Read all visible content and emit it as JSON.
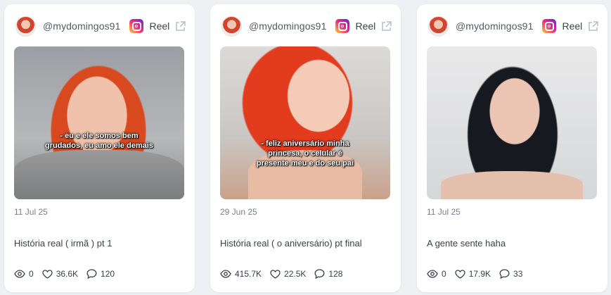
{
  "cards": [
    {
      "handle": "@mydomingos91",
      "type": "Reel",
      "caption": "- eu e ele somos bem\ngrudados, eu amo ele demais",
      "date": "11 Jul 25",
      "title": "História real ( irmã ) pt 1",
      "views": "0",
      "likes": "36.6K",
      "comments": "120"
    },
    {
      "handle": "@mydomingos91",
      "type": "Reel",
      "caption": "- feliz aniversário minha\nprincesa, o celular é\npresente meu e do seu pai",
      "date": "29 Jun 25",
      "title": "História real ( o aniversário) pt final",
      "views": "415.7K",
      "likes": "22.5K",
      "comments": "128"
    },
    {
      "handle": "@mydomingos91",
      "type": "Reel",
      "date": "11 Jul 25",
      "title": "A gente sente haha",
      "views": "0",
      "likes": "17.9K",
      "comments": "33"
    }
  ],
  "icons": {
    "platform": "instagram-icon",
    "external": "external-link-icon",
    "views": "eye-icon",
    "likes": "heart-icon",
    "comments": "comment-icon"
  },
  "colors": {
    "background": "#eef0f4",
    "card": "#ffffff",
    "text_muted": "#7b8088",
    "text": "#3a4048"
  }
}
